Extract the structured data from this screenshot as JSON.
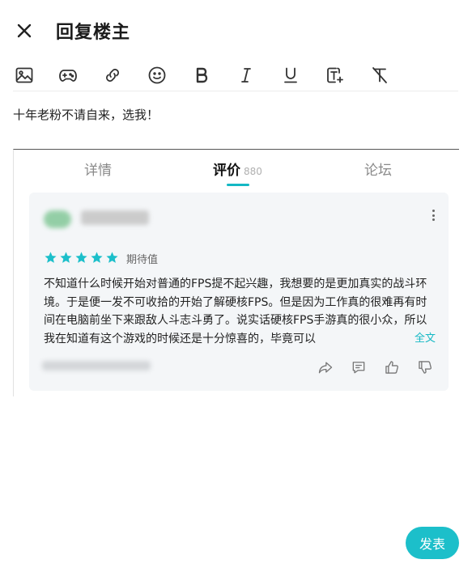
{
  "header": {
    "title": "回复楼主"
  },
  "toolbar": {
    "tools": [
      {
        "name": "image-icon"
      },
      {
        "name": "gamepad-icon"
      },
      {
        "name": "link-icon"
      },
      {
        "name": "emoji-icon"
      },
      {
        "name": "bold-icon"
      },
      {
        "name": "italic-icon"
      },
      {
        "name": "underline-icon"
      },
      {
        "name": "text-size-icon"
      },
      {
        "name": "clear-format-icon"
      }
    ]
  },
  "editor": {
    "content": "十年老粉不请自来，选我！"
  },
  "tabs": {
    "items": [
      {
        "label": "详情"
      },
      {
        "label": "评价",
        "count": "880"
      },
      {
        "label": "论坛"
      }
    ],
    "active": 1
  },
  "review": {
    "stars": 5,
    "rating_label": "期待值",
    "text": "不知道什么时候开始对普通的FPS提不起兴趣，我想要的是更加真实的战斗环境。于是便一发不可收拾的开始了解硬核FPS。但是因为工作真的很难再有时间在电脑前坐下来跟敌人斗志斗勇了。说实话硬核FPS手游真的很小众，所以我在知道有这个游戏的时候还是十分惊喜的，毕竟可以",
    "full_text_link": "全文"
  },
  "footer": {
    "submit_label": "发表"
  },
  "colors": {
    "accent": "#1cbfca",
    "text": "#222222"
  }
}
